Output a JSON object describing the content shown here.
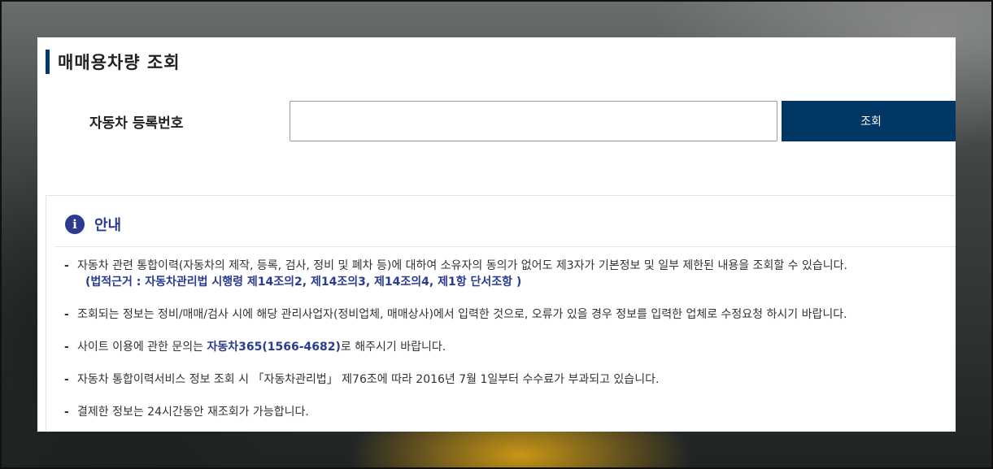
{
  "page": {
    "title": "매매용차량 조회"
  },
  "search": {
    "label": "자동차 등록번호",
    "value": "",
    "placeholder": "",
    "button_label": "조회"
  },
  "info": {
    "icon": "info-icon",
    "icon_glyph": "i",
    "title": "안내",
    "items": [
      {
        "text": "자동차 관련 통합이력(자동차의 제작, 등록, 검사, 정비 및 폐차 등)에 대하여 소유자의 동의가 없어도 제3자가 기본정보 및 일부 제한된 내용을 조회할 수 있습니다.",
        "legal": "(법적근거 : 자동차관리법 시행령 제14조의2, 제14조의3, 제14조의4, 제1항 단서조항 )"
      },
      {
        "text": "조회되는 정보는 정비/매매/검사 시에 해당 관리사업자(정비업체, 매매상사)에서 입력한 것으로, 오류가 있을 경우 정보를 입력한 업체로 수정요청 하시기 바랍니다."
      },
      {
        "pre": "사이트 이용에 관한 문의는 ",
        "highlight": "자동차365(1566-4682)",
        "post": "로 해주시기 바랍니다."
      },
      {
        "text": "자동차 통합이력서비스 정보 조회 시 「자동차관리법」 제76조에 따라 2016년 7월 1일부터 수수료가 부과되고 있습니다."
      },
      {
        "text": "결제한 정보는 24시간동안 재조회가 가능합니다."
      }
    ],
    "bullet": "-"
  },
  "colors": {
    "accent": "#013764",
    "highlight": "#2b3b8f"
  }
}
